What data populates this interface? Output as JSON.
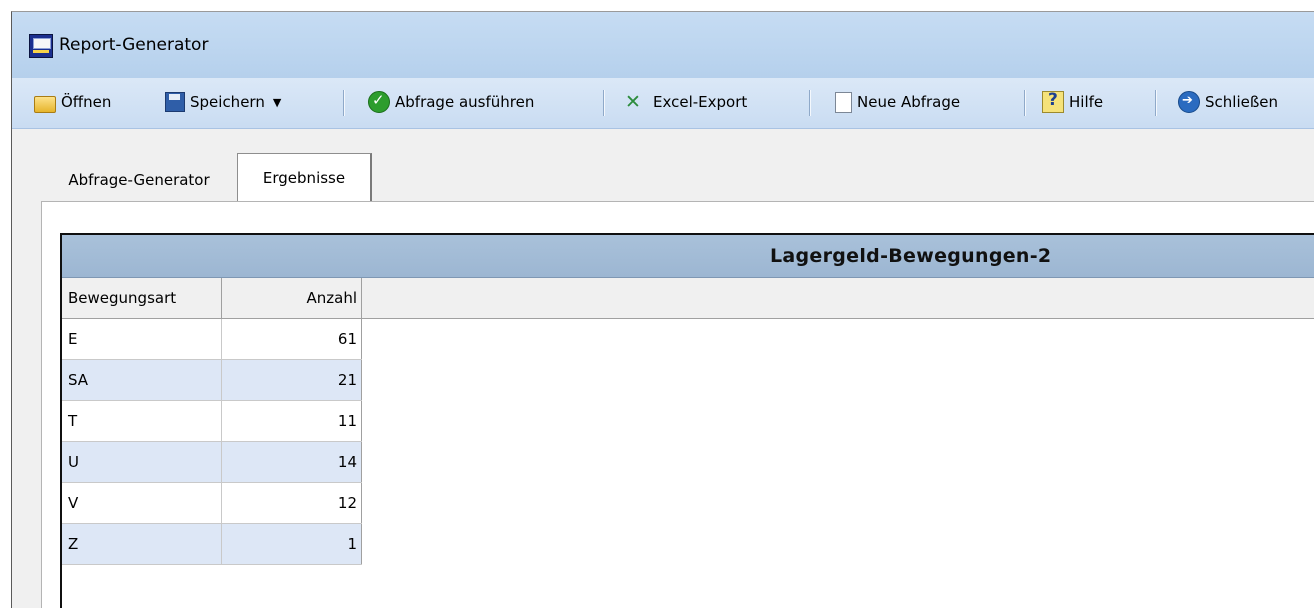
{
  "window": {
    "title": "Report-Generator"
  },
  "toolbar": {
    "open_label": "Öffnen",
    "save_label": "Speichern",
    "run_label": "Abfrage ausführen",
    "excel_label": "Excel-Export",
    "new_label": "Neue Abfrage",
    "help_label": "Hilfe",
    "close_label": "Schließen"
  },
  "tabs": [
    {
      "label": "Abfrage-Generator",
      "active": false
    },
    {
      "label": "Ergebnisse",
      "active": true
    }
  ],
  "grid": {
    "title": "Lagergeld-Bewegungen-2",
    "columns": [
      "Bewegungsart",
      "Anzahl"
    ],
    "rows": [
      [
        "E",
        "61"
      ],
      [
        "SA",
        "21"
      ],
      [
        "T",
        "11"
      ],
      [
        "U",
        "14"
      ],
      [
        "V",
        "12"
      ],
      [
        "Z",
        "1"
      ]
    ]
  }
}
